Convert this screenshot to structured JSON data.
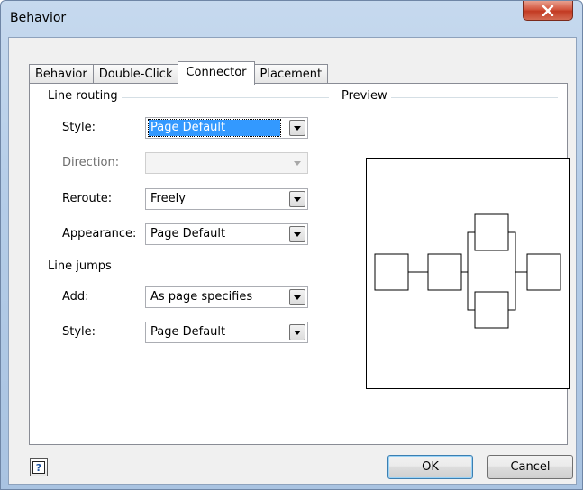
{
  "window": {
    "title": "Behavior"
  },
  "tabs": [
    {
      "label": "Behavior",
      "active": false
    },
    {
      "label": "Double-Click",
      "active": false
    },
    {
      "label": "Connector",
      "active": true
    },
    {
      "label": "Placement",
      "active": false
    }
  ],
  "line_routing": {
    "group_label": "Line routing",
    "style_label": "Style:",
    "style_value": "Page Default",
    "direction_label": "Direction:",
    "direction_value": "",
    "reroute_label": "Reroute:",
    "reroute_value": "Freely",
    "appearance_label": "Appearance:",
    "appearance_value": "Page Default"
  },
  "line_jumps": {
    "group_label": "Line jumps",
    "add_label": "Add:",
    "add_value": "As page specifies",
    "style_label": "Style:",
    "style_value": "Page Default"
  },
  "preview": {
    "label": "Preview"
  },
  "buttons": {
    "ok": "OK",
    "cancel": "Cancel",
    "help_glyph": "?"
  },
  "icons": [
    "close-icon",
    "dropdown-arrow-icon",
    "help-icon"
  ],
  "colors": {
    "selection": "#3399ff",
    "close_button": "#c94a32",
    "title_gradient": "#b5cde8"
  }
}
